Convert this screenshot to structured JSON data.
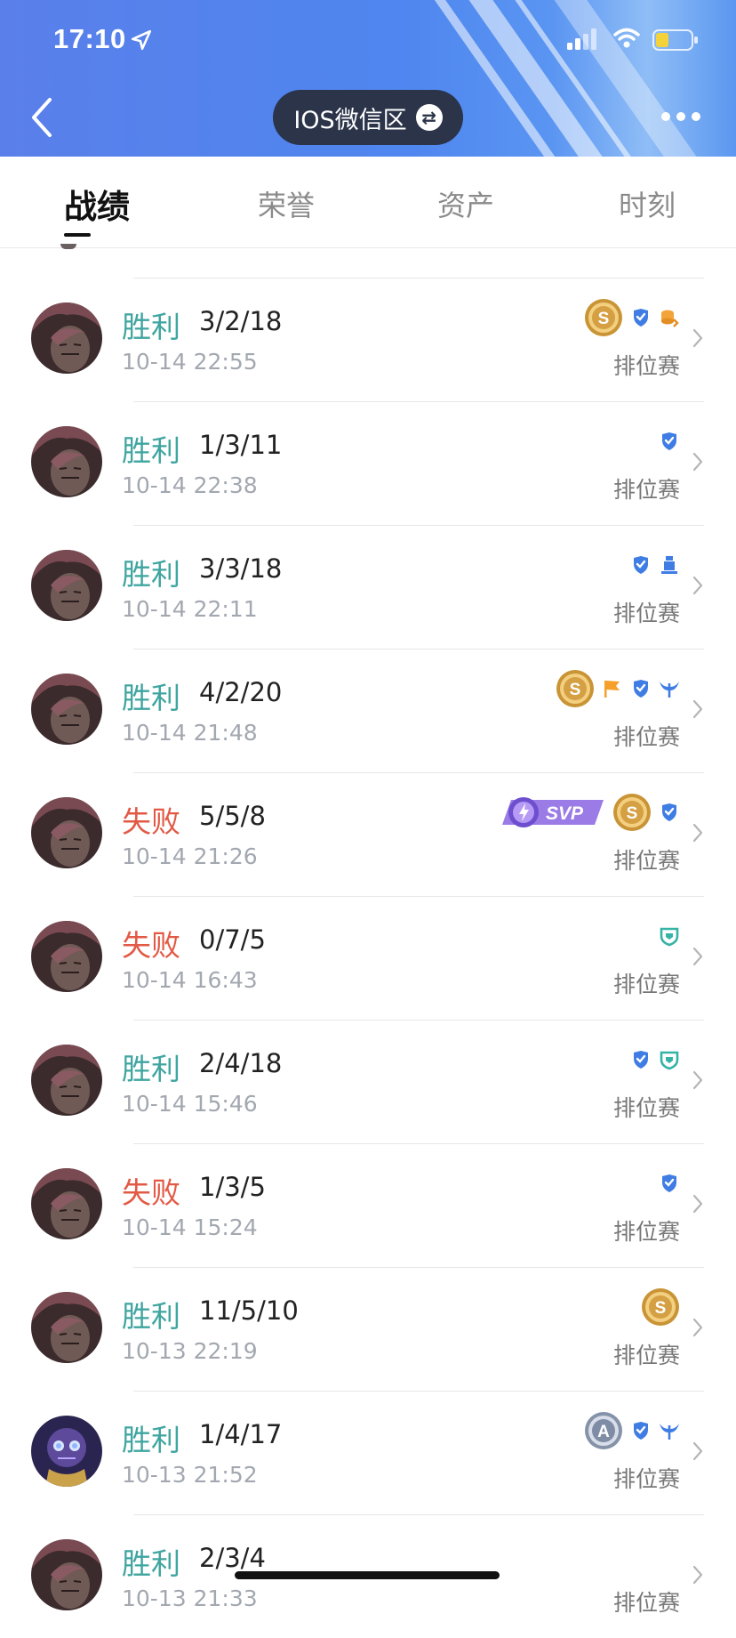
{
  "status_bar": {
    "time": "17:10"
  },
  "header": {
    "server_label": "IOS微信区"
  },
  "tabs": [
    {
      "label": "战绩",
      "active": true
    },
    {
      "label": "荣誉",
      "active": false
    },
    {
      "label": "资产",
      "active": false
    },
    {
      "label": "时刻",
      "active": false
    }
  ],
  "colors": {
    "win": "#3fa5a0",
    "lose": "#e25a46",
    "header": "#4f86ef"
  },
  "matches": [
    {
      "result": "胜利",
      "outcome": "win",
      "kda": "3/2/18",
      "time": "10-14 22:55",
      "mode": "排位赛",
      "hero": "hero-portrait-dark",
      "badges": [
        "medal-s-gold",
        "ranked-badge-icon",
        "coin-stack-icon"
      ]
    },
    {
      "result": "胜利",
      "outcome": "win",
      "kda": "1/3/11",
      "time": "10-14 22:38",
      "mode": "排位赛",
      "hero": "hero-portrait-dark",
      "badges": [
        "ranked-badge-icon"
      ]
    },
    {
      "result": "胜利",
      "outcome": "win",
      "kda": "3/3/18",
      "time": "10-14 22:11",
      "mode": "排位赛",
      "hero": "hero-portrait-dark",
      "badges": [
        "ranked-badge-icon",
        "tower-icon"
      ]
    },
    {
      "result": "胜利",
      "outcome": "win",
      "kda": "4/2/20",
      "time": "10-14 21:48",
      "mode": "排位赛",
      "hero": "hero-portrait-dark",
      "badges": [
        "medal-s-gold",
        "flag-icon",
        "ranked-badge-icon",
        "wings-icon"
      ]
    },
    {
      "result": "失败",
      "outcome": "lose",
      "kda": "5/5/8",
      "time": "10-14 21:26",
      "mode": "排位赛",
      "hero": "hero-portrait-dark",
      "badges": [
        "svp-badge",
        "medal-s-gold",
        "ranked-badge-icon"
      ],
      "svp_label": "SVP"
    },
    {
      "result": "失败",
      "outcome": "lose",
      "kda": "0/7/5",
      "time": "10-14 16:43",
      "mode": "排位赛",
      "hero": "hero-portrait-dark",
      "badges": [
        "shield-icon"
      ]
    },
    {
      "result": "胜利",
      "outcome": "win",
      "kda": "2/4/18",
      "time": "10-14 15:46",
      "mode": "排位赛",
      "hero": "hero-portrait-dark",
      "badges": [
        "ranked-badge-icon",
        "shield-icon"
      ]
    },
    {
      "result": "失败",
      "outcome": "lose",
      "kda": "1/3/5",
      "time": "10-14 15:24",
      "mode": "排位赛",
      "hero": "hero-portrait-dark",
      "badges": [
        "ranked-badge-icon"
      ]
    },
    {
      "result": "胜利",
      "outcome": "win",
      "kda": "11/5/10",
      "time": "10-13 22:19",
      "mode": "排位赛",
      "hero": "hero-portrait-dark",
      "badges": [
        "medal-s-gold"
      ]
    },
    {
      "result": "胜利",
      "outcome": "win",
      "kda": "1/4/17",
      "time": "10-13 21:52",
      "mode": "排位赛",
      "hero": "hero-portrait-mech",
      "badges": [
        "medal-a-silver",
        "ranked-badge-icon",
        "wings-icon"
      ]
    },
    {
      "result": "胜利",
      "outcome": "win",
      "kda": "2/3/4",
      "time": "10-13 21:33",
      "mode": "排位赛",
      "hero": "hero-portrait-dark",
      "badges": []
    }
  ]
}
